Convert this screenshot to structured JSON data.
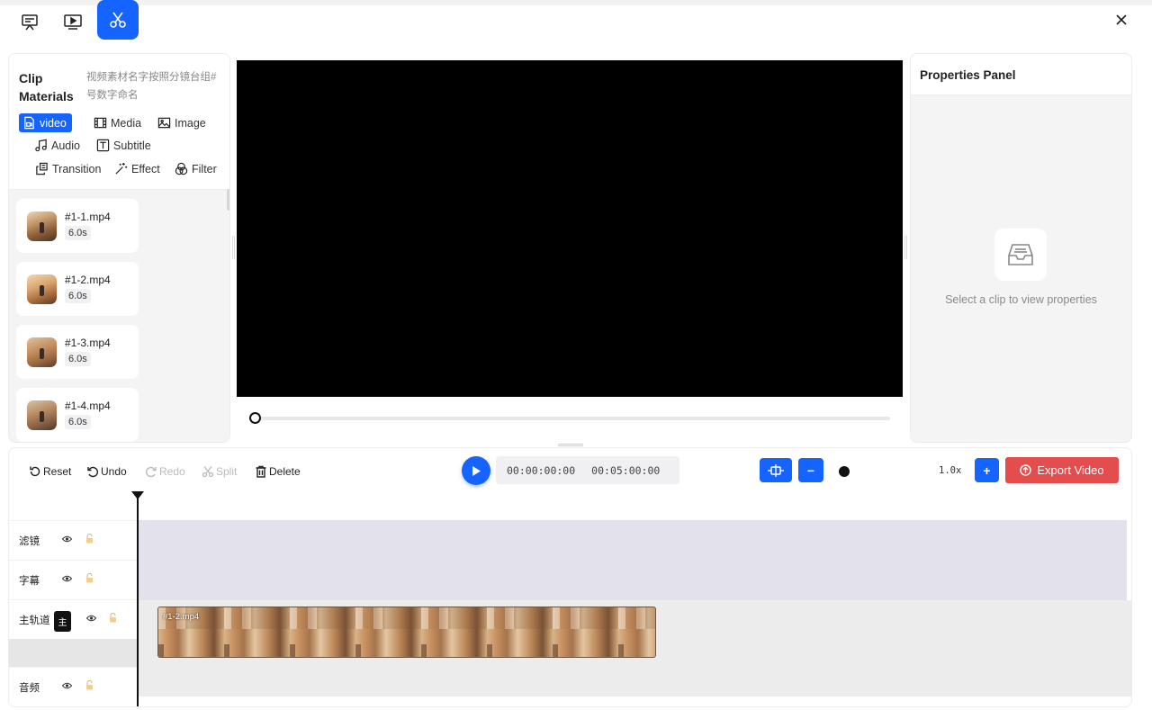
{
  "topbar": {
    "modes": [
      {
        "icon": "presentation-icon",
        "active": false
      },
      {
        "icon": "monitor-play-icon",
        "active": false
      },
      {
        "icon": "scissors-icon",
        "active": true
      }
    ],
    "close_icon": "close-icon"
  },
  "clip_materials": {
    "title": "Clip Materials",
    "description": "视频素材名字按照分镜台组#号数字命名",
    "tabs": [
      {
        "label": "video",
        "icon": "video-file-icon",
        "active": true
      },
      {
        "label": "Media",
        "icon": "film-icon",
        "active": false
      },
      {
        "label": "Image",
        "icon": "image-icon",
        "active": false
      },
      {
        "label": "Audio",
        "icon": "music-note-icon",
        "active": false
      },
      {
        "label": "Subtitle",
        "icon": "text-box-icon",
        "active": false
      },
      {
        "label": "Transition",
        "icon": "transition-icon",
        "active": false
      },
      {
        "label": "Effect",
        "icon": "magic-wand-icon",
        "active": false
      },
      {
        "label": "Filter",
        "icon": "filter-circles-icon",
        "active": false
      }
    ],
    "clips": [
      {
        "name": "#1-1.mp4",
        "duration": "6.0s"
      },
      {
        "name": "#1-2.mp4",
        "duration": "6.0s"
      },
      {
        "name": "#1-3.mp4",
        "duration": "6.0s"
      },
      {
        "name": "#1-4.mp4",
        "duration": "6.0s"
      }
    ]
  },
  "player": {
    "progress": 0
  },
  "properties": {
    "title": "Properties Panel",
    "empty_text": "Select a clip to view properties",
    "empty_icon": "inbox-icon"
  },
  "toolbar": {
    "reset": "Reset",
    "undo": "Undo",
    "redo": "Redo",
    "split": "Split",
    "delete": "Delete",
    "current_time": "00:00:00:00",
    "total_time": "00:05:00:00",
    "zoom": "1.0x",
    "export": "Export Video",
    "colors": {
      "accent": "#1664ff",
      "export": "#e34d4d"
    }
  },
  "tracks": [
    {
      "label": "滤镜"
    },
    {
      "label": "字幕"
    },
    {
      "label": "主轨道",
      "badge": "主"
    },
    {
      "label": "音频"
    }
  ],
  "timeline_clip": {
    "label": "#1-2.mp4"
  }
}
